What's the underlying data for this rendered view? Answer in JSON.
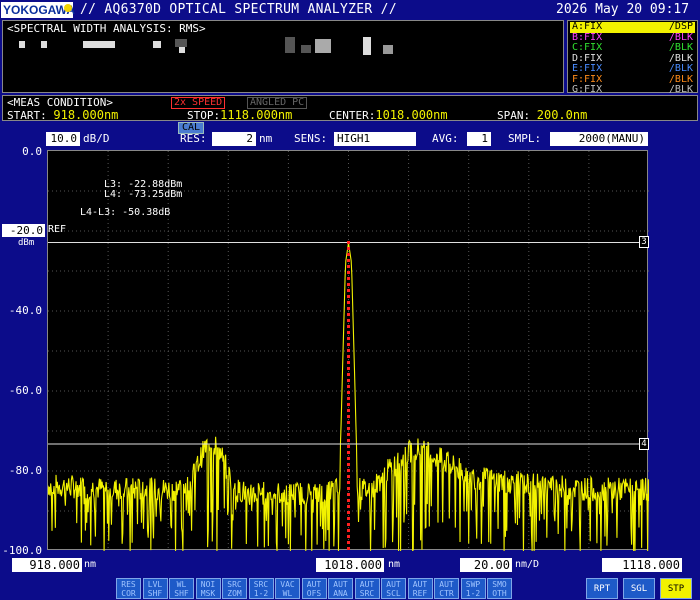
{
  "header": {
    "brand": "YOKOGAWA",
    "title": "// AQ6370D OPTICAL SPECTRUM ANALYZER //",
    "datetime": "2026 May 20 09:17"
  },
  "analysis": {
    "title": "<SPECTRAL WIDTH ANALYSIS: RMS>"
  },
  "traces": [
    {
      "label": "A:FIX",
      "mode": "/DSP",
      "color": "#f2f200",
      "active": true
    },
    {
      "label": "B:FIX",
      "mode": "/BLK",
      "color": "#ff40ff",
      "active": false
    },
    {
      "label": "C:FIX",
      "mode": "/BLK",
      "color": "#30e030",
      "active": false
    },
    {
      "label": "D:FIX",
      "mode": "/BLK",
      "color": "#e0e0e0",
      "active": false
    },
    {
      "label": "E:FIX",
      "mode": "/BLK",
      "color": "#4a8cff",
      "active": false
    },
    {
      "label": "F:FIX",
      "mode": "/BLK",
      "color": "#ff8c1a",
      "active": false
    },
    {
      "label": "G:FIX",
      "mode": "/BLK",
      "color": "#c0c0c0",
      "active": false
    }
  ],
  "meas": {
    "title": "<MEAS CONDITION>",
    "speed_badge": "2x SPEED",
    "angled_badge": "ANGLED PC",
    "start_label": "START:",
    "start_value": "918.000nm",
    "stop_label": "STOP:",
    "stop_value": "1118.000nm",
    "center_label": "CENTER:",
    "center_value": "1018.000nm",
    "span_label": "SPAN:",
    "span_value": "200.0nm"
  },
  "settings": {
    "scale_value": "10.0",
    "scale_unit": "dB/D",
    "cal": "CAL",
    "res_label": "RES:",
    "res_value": "2",
    "res_unit": "nm",
    "sens_label": "SENS:",
    "sens_value": "HIGH1",
    "avg_label": "AVG:",
    "avg_value": "1",
    "smpl_label": "SMPL:",
    "smpl_value": "2000(MANU)"
  },
  "graph": {
    "y_ticks": [
      "0.0",
      "-40.0",
      "-60.0",
      "-80.0",
      "-100.0"
    ],
    "ref_value": "-20.0",
    "ref_label": "REF",
    "ref_unit": "dBm",
    "marker_l3_tag": "3",
    "marker_l4_tag": "4",
    "l3_readout": "L3:  -22.88dBm",
    "l4_readout": "L4:  -73.25dBm",
    "diff_readout": "L4-L3:  -50.38dB"
  },
  "x_axis": {
    "start": "918.000",
    "start_unit": "nm",
    "center": "1018.000",
    "center_unit": "nm",
    "div": "20.00",
    "div_unit": "nm/D",
    "stop": "1118.000"
  },
  "softkeys": [
    {
      "l1": "RES",
      "l2": "COR"
    },
    {
      "l1": "LVL",
      "l2": "SHF"
    },
    {
      "l1": "WL",
      "l2": "SHF"
    },
    {
      "l1": "NOI",
      "l2": "MSK"
    },
    {
      "l1": "SRC",
      "l2": "ZOM"
    },
    {
      "l1": "SRC",
      "l2": "1-2"
    },
    {
      "l1": "VAC",
      "l2": "WL"
    },
    {
      "l1": "AUT",
      "l2": "OFS"
    },
    {
      "l1": "AUT",
      "l2": "ANA"
    },
    {
      "l1": "AUT",
      "l2": "SRC"
    },
    {
      "l1": "AUT",
      "l2": "SCL"
    },
    {
      "l1": "AUT",
      "l2": "REF"
    },
    {
      "l1": "AUT",
      "l2": "CTR"
    },
    {
      "l1": "SWP",
      "l2": "1-2"
    },
    {
      "l1": "SMO",
      "l2": "OTH"
    }
  ],
  "sweep_buttons": [
    "RPT",
    "SGL",
    "STP"
  ],
  "chart_data": {
    "type": "line",
    "xlabel": "",
    "ylabel": "",
    "xlim": [
      918,
      1118
    ],
    "ylim": [
      -100,
      0
    ],
    "series": [
      {
        "color": "#f2f200",
        "x": [
          918,
          930,
          940,
          950,
          960,
          965,
          970,
          972,
          974,
          976,
          980,
          985,
          990,
          1000,
          1005,
          1010,
          1013,
          1015,
          1016,
          1017,
          1018,
          1019,
          1020,
          1021,
          1023,
          1026,
          1030,
          1035,
          1040,
          1050,
          1060,
          1070,
          1080,
          1090,
          1100,
          1110,
          1118
        ],
        "y": [
          -83,
          -83.5,
          -84,
          -84,
          -84,
          -83,
          -74,
          -72,
          -73,
          -76,
          -84,
          -85,
          -85,
          -85,
          -85,
          -85,
          -84,
          -84,
          -55,
          -28,
          -23,
          -28,
          -55,
          -84,
          -84,
          -84,
          -80,
          -77,
          -73.5,
          -77,
          -81,
          -82,
          -83,
          -83.5,
          -84,
          -84,
          -84
        ]
      }
    ],
    "markers": [
      {
        "name": "L3",
        "y": -22.88
      },
      {
        "name": "L4",
        "y": -73.25
      }
    ]
  }
}
